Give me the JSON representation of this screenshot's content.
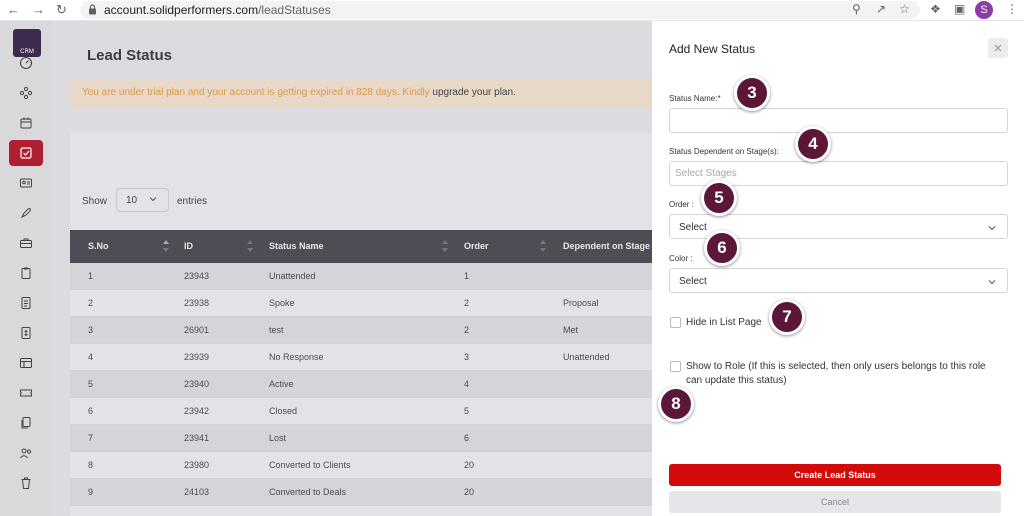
{
  "browser": {
    "url_host": "account.solidperformers.com",
    "url_path": "/leadStatuses",
    "profile_initial": "S"
  },
  "sidebar": {
    "logo_text": "CRM",
    "items": [
      {
        "icon": "dashboard-icon"
      },
      {
        "icon": "network-icon"
      },
      {
        "icon": "calendar-icon"
      },
      {
        "icon": "checkbox-icon",
        "active": true
      },
      {
        "icon": "contact-card-icon"
      },
      {
        "icon": "rocket-icon"
      },
      {
        "icon": "briefcase-icon"
      },
      {
        "icon": "clipboard-icon"
      },
      {
        "icon": "document-icon"
      },
      {
        "icon": "invoice-icon"
      },
      {
        "icon": "table-icon"
      },
      {
        "icon": "ticket-icon"
      },
      {
        "icon": "files-icon"
      },
      {
        "icon": "users-icon"
      },
      {
        "icon": "trash-icon"
      }
    ]
  },
  "main": {
    "title": "Lead Status",
    "trial_text": "You are under trial plan and your account is getting expired in 828 days. Kindly",
    "trial_link": "upgrade your plan.",
    "show_label": "Show",
    "entries_value": "10",
    "entries_label": "entries",
    "columns": [
      "S.No",
      "ID",
      "Status Name",
      "Order",
      "Dependent on Stage"
    ],
    "rows": [
      {
        "sno": "1",
        "id": "23943",
        "name": "Unattended",
        "order": "1",
        "stage": ""
      },
      {
        "sno": "2",
        "id": "23938",
        "name": "Spoke",
        "order": "2",
        "stage": "Proposal"
      },
      {
        "sno": "3",
        "id": "26901",
        "name": "test",
        "order": "2",
        "stage": "Met"
      },
      {
        "sno": "4",
        "id": "23939",
        "name": "No Response",
        "order": "3",
        "stage": "Unattended"
      },
      {
        "sno": "5",
        "id": "23940",
        "name": "Active",
        "order": "4",
        "stage": ""
      },
      {
        "sno": "6",
        "id": "23942",
        "name": "Closed",
        "order": "5",
        "stage": ""
      },
      {
        "sno": "7",
        "id": "23941",
        "name": "Lost",
        "order": "6",
        "stage": ""
      },
      {
        "sno": "8",
        "id": "23980",
        "name": "Converted to Clients",
        "order": "20",
        "stage": ""
      },
      {
        "sno": "9",
        "id": "24103",
        "name": "Converted to Deals",
        "order": "20",
        "stage": ""
      }
    ]
  },
  "panel": {
    "title": "Add New Status",
    "status_name_label": "Status Name:*",
    "status_name_value": "",
    "stages_label": "Status Dependent on Stage(s):",
    "stages_placeholder": "Select Stages",
    "order_label": "Order :",
    "order_value": "Select",
    "color_label": "Color :",
    "color_value": "Select",
    "hide_label": "Hide in List Page",
    "show_role_label_1": "Show to Role (If this is selected, then only users belongs to this role",
    "show_role_label_2": "can update this status)",
    "create_button": "Create Lead Status",
    "cancel_button": "Cancel"
  },
  "callouts": [
    "3",
    "4",
    "5",
    "6",
    "7",
    "8"
  ],
  "colors": {
    "accent_red": "#d20a0a",
    "sidebar_active": "#b01f31",
    "badge": "#5c1638",
    "table_header": "#4d4d56",
    "trial_text": "#dc9a4a"
  }
}
